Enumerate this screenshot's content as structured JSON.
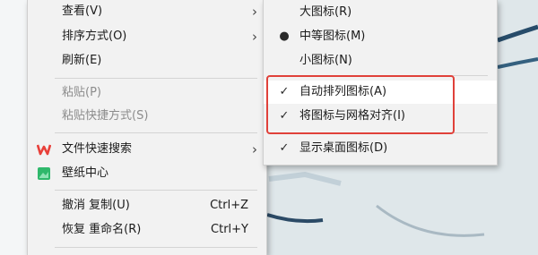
{
  "context_menu": {
    "items": [
      {
        "label": "查看(V)",
        "has_submenu": true
      },
      {
        "label": "排序方式(O)",
        "has_submenu": true
      },
      {
        "label": "刷新(E)"
      },
      {
        "label": "粘贴(P)",
        "disabled": true
      },
      {
        "label": "粘贴快捷方式(S)",
        "disabled": true
      },
      {
        "label": "文件快速搜索",
        "has_submenu": true,
        "icon": "wps-icon"
      },
      {
        "label": "壁纸中心",
        "icon": "wallpaper-icon"
      },
      {
        "label": "撤消 复制(U)",
        "shortcut": "Ctrl+Z"
      },
      {
        "label": "恢复 重命名(R)",
        "shortcut": "Ctrl+Y"
      }
    ]
  },
  "view_submenu": {
    "items": [
      {
        "label": "大图标(R)",
        "mark": ""
      },
      {
        "label": "中等图标(M)",
        "mark": "bullet"
      },
      {
        "label": "小图标(N)",
        "mark": ""
      },
      {
        "label": "自动排列图标(A)",
        "mark": "check"
      },
      {
        "label": "将图标与网格对齐(I)",
        "mark": "check"
      },
      {
        "label": "显示桌面图标(D)",
        "mark": "check"
      }
    ]
  },
  "colors": {
    "menu_bg": "#f2f2f2",
    "highlight_border": "#e0413a",
    "wps_red": "#e8403a",
    "wallpaper_green": "#2fb86b"
  }
}
